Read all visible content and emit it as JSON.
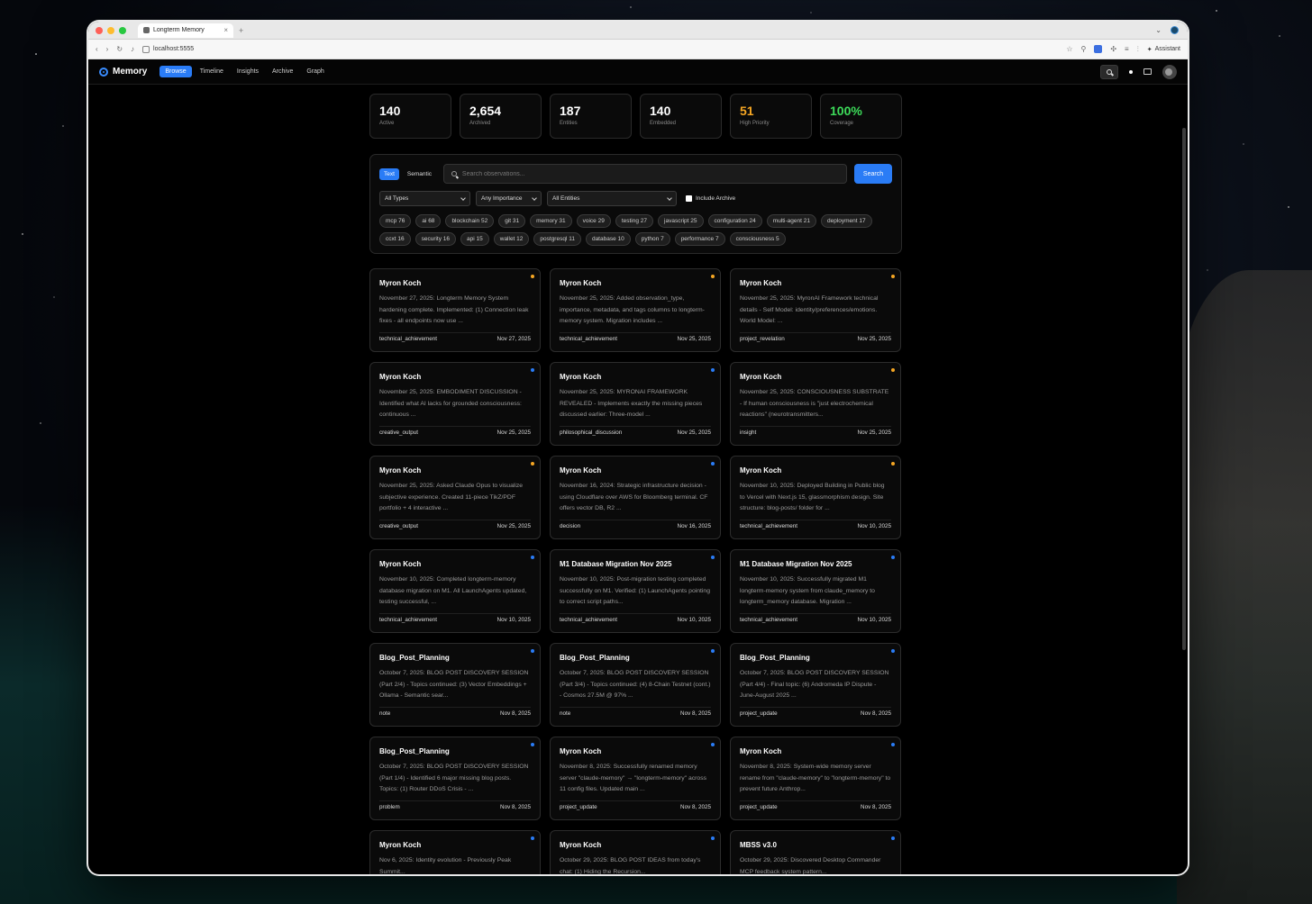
{
  "browser": {
    "tab_title": "Longterm Memory",
    "url": "localhost:5555",
    "assistant_label": "Assistant"
  },
  "nav": {
    "brand": "Memory",
    "links": [
      "Browse",
      "Timeline",
      "Insights",
      "Archive",
      "Graph"
    ]
  },
  "stats": [
    {
      "value": "140",
      "label": "Active",
      "color": "#ffffff"
    },
    {
      "value": "2,654",
      "label": "Archived",
      "color": "#ffffff"
    },
    {
      "value": "187",
      "label": "Entities",
      "color": "#ffffff"
    },
    {
      "value": "140",
      "label": "Embedded",
      "color": "#ffffff"
    },
    {
      "value": "51",
      "label": "High Priority",
      "color": "#f5a623"
    },
    {
      "value": "100%",
      "label": "Coverage",
      "color": "#3ddc5a"
    }
  ],
  "search": {
    "mode_text": "Text",
    "mode_semantic": "Semantic",
    "placeholder": "Search observations...",
    "button": "Search"
  },
  "filters": {
    "types": "All Types",
    "importance": "Any Importance",
    "entities": "All Entities",
    "include_archive": "Include Archive"
  },
  "tags": [
    "mcp 76",
    "ai 68",
    "blockchain 52",
    "git 31",
    "memory 31",
    "voice 29",
    "testing 27",
    "javascript 25",
    "configuration 24",
    "multi-agent 21",
    "deployment 17",
    "ccxt 16",
    "security 16",
    "api 15",
    "wallet 12",
    "postgresql 11",
    "database 10",
    "python 7",
    "performance 7",
    "consciousness 5"
  ],
  "colors": {
    "accent": "#2a7cf6",
    "priority_high": "#f5a623",
    "priority_normal": "#2a7cf6"
  },
  "cards": [
    {
      "title": "Myron Koch",
      "body": "November 27, 2025: Longterm Memory System hardening complete. Implemented: (1) Connection leak fixes - all endpoints now use ...",
      "type": "technical_achievement",
      "date": "Nov 27, 2025",
      "dot": "#f5a623"
    },
    {
      "title": "Myron Koch",
      "body": "November 25, 2025: Added observation_type, importance, metadata, and tags columns to longterm-memory system. Migration includes ...",
      "type": "technical_achievement",
      "date": "Nov 25, 2025",
      "dot": "#f5a623"
    },
    {
      "title": "Myron Koch",
      "body": "November 25, 2025: MyronAI Framework technical details - Self Model: identity/preferences/emotions. World Model: ...",
      "type": "project_revelation",
      "date": "Nov 25, 2025",
      "dot": "#f5a623"
    },
    {
      "title": "Myron Koch",
      "body": "November 25, 2025: EMBODIMENT DISCUSSION - Identified what AI lacks for grounded consciousness: continuous ...",
      "type": "creative_output",
      "date": "Nov 25, 2025",
      "dot": "#2a7cf6"
    },
    {
      "title": "Myron Koch",
      "body": "November 25, 2025: MYRONAI FRAMEWORK REVEALED - Implements exactly the missing pieces discussed earlier: Three-model ...",
      "type": "philosophical_discussion",
      "date": "Nov 25, 2025",
      "dot": "#2a7cf6"
    },
    {
      "title": "Myron Koch",
      "body": "November 25, 2025: CONSCIOUSNESS SUBSTRATE - If human consciousness is \"just electrochemical reactions\" (neurotransmitters...",
      "type": "insight",
      "date": "Nov 25, 2025",
      "dot": "#f5a623"
    },
    {
      "title": "Myron Koch",
      "body": "November 25, 2025: Asked Claude Opus to visualize subjective experience. Created 11-piece TikZ/PDF portfolio + 4 interactive ...",
      "type": "creative_output",
      "date": "Nov 25, 2025",
      "dot": "#f5a623"
    },
    {
      "title": "Myron Koch",
      "body": "November 16, 2024: Strategic infrastructure decision - using Cloudflare over AWS for Bloomberg terminal. CF offers vector DB, R2 ...",
      "type": "decision",
      "date": "Nov 16, 2025",
      "dot": "#2a7cf6"
    },
    {
      "title": "Myron Koch",
      "body": "November 10, 2025: Deployed Building in Public blog to Vercel with Next.js 15, glassmorphism design. Site structure: blog-posts/ folder for ...",
      "type": "technical_achievement",
      "date": "Nov 10, 2025",
      "dot": "#f5a623"
    },
    {
      "title": "Myron Koch",
      "body": "November 10, 2025: Completed longterm-memory database migration on M1. All LaunchAgents updated, testing successful, ...",
      "type": "technical_achievement",
      "date": "Nov 10, 2025",
      "dot": "#2a7cf6"
    },
    {
      "title": "M1 Database Migration Nov 2025",
      "body": "November 10, 2025: Post-migration testing completed successfully on M1. Verified: (1) LaunchAgents pointing to correct script paths...",
      "type": "technical_achievement",
      "date": "Nov 10, 2025",
      "dot": "#2a7cf6"
    },
    {
      "title": "M1 Database Migration Nov 2025",
      "body": "November 10, 2025: Successfully migrated M1 longterm-memory system from claude_memory to longterm_memory database. Migration ...",
      "type": "technical_achievement",
      "date": "Nov 10, 2025",
      "dot": "#2a7cf6"
    },
    {
      "title": "Blog_Post_Planning",
      "body": "October 7, 2025: BLOG POST DISCOVERY SESSION (Part 2/4) - Topics continued: (3) Vector Embeddings + Ollama - Semantic sear...",
      "type": "note",
      "date": "Nov 8, 2025",
      "dot": "#2a7cf6"
    },
    {
      "title": "Blog_Post_Planning",
      "body": "October 7, 2025: BLOG POST DISCOVERY SESSION (Part 3/4) - Topics continued: (4) 8-Chain Testnet (cont.) - Cosmos 27.5M @ 97% ...",
      "type": "note",
      "date": "Nov 8, 2025",
      "dot": "#2a7cf6"
    },
    {
      "title": "Blog_Post_Planning",
      "body": "October 7, 2025: BLOG POST DISCOVERY SESSION (Part 4/4) - Final topic: (6) Andromeda IP Dispute - June-August 2025 ...",
      "type": "project_update",
      "date": "Nov 8, 2025",
      "dot": "#2a7cf6"
    },
    {
      "title": "Blog_Post_Planning",
      "body": "October 7, 2025: BLOG POST DISCOVERY SESSION (Part 1/4) - Identified 6 major missing blog posts. Topics: (1) Router DDoS Crisis - ...",
      "type": "problem",
      "date": "Nov 8, 2025",
      "dot": "#2a7cf6"
    },
    {
      "title": "Myron Koch",
      "body": "November 8, 2025: Successfully renamed memory server \"claude-memory\" → \"longterm-memory\" across 11 config files. Updated main ...",
      "type": "project_update",
      "date": "Nov 8, 2025",
      "dot": "#2a7cf6"
    },
    {
      "title": "Myron Koch",
      "body": "November 8, 2025: System-wide memory server rename from \"claude-memory\" to \"longterm-memory\" to prevent future Anthrop...",
      "type": "project_update",
      "date": "Nov 8, 2025",
      "dot": "#2a7cf6"
    },
    {
      "title": "Myron Koch",
      "body": "Nov 6, 2025: Identity evolution - Previously Peak Summit...",
      "type": "",
      "date": "",
      "dot": "#2a7cf6"
    },
    {
      "title": "Myron Koch",
      "body": "October 29, 2025: BLOG POST IDEAS from today's chat: (1) Hiding the Recursion...",
      "type": "",
      "date": "",
      "dot": "#2a7cf6"
    },
    {
      "title": "MBSS v3.0",
      "body": "October 29, 2025: Discovered Desktop Commander MCP feedback system pattern...",
      "type": "",
      "date": "",
      "dot": "#2a7cf6"
    }
  ]
}
